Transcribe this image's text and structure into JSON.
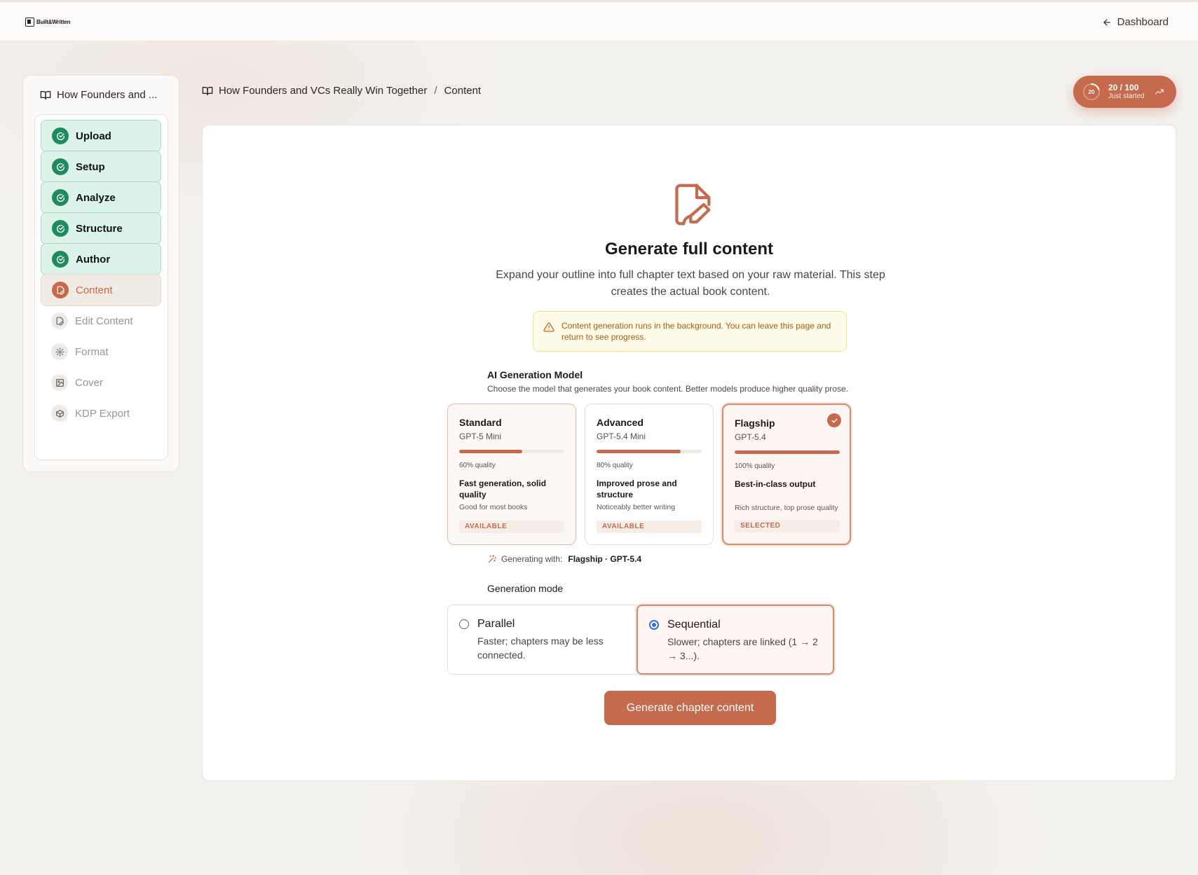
{
  "app": {
    "logo_text": "Built&Written"
  },
  "topbar": {
    "dashboard_label": "Dashboard"
  },
  "sidebar": {
    "book_title": "How Founders and ...",
    "steps": [
      {
        "label": "Upload",
        "state": "done",
        "icon": "check-circle-icon"
      },
      {
        "label": "Setup",
        "state": "done",
        "icon": "check-circle-icon"
      },
      {
        "label": "Analyze",
        "state": "done",
        "icon": "check-circle-icon"
      },
      {
        "label": "Structure",
        "state": "done",
        "icon": "check-circle-icon"
      },
      {
        "label": "Author",
        "state": "done",
        "icon": "check-circle-icon"
      },
      {
        "label": "Content",
        "state": "current",
        "icon": "file-pen-icon"
      },
      {
        "label": "Edit Content",
        "state": "todo",
        "icon": "file-pen-icon"
      },
      {
        "label": "Format",
        "state": "todo",
        "icon": "gear-icon"
      },
      {
        "label": "Cover",
        "state": "todo",
        "icon": "image-icon"
      },
      {
        "label": "KDP Export",
        "state": "todo",
        "icon": "package-icon"
      }
    ]
  },
  "breadcrumb": {
    "book": "How Founders and VCs Really Win Together",
    "separator": "/",
    "page": "Content"
  },
  "score": {
    "ring_value": "20",
    "value_text": "20 / 100",
    "status": "Just started",
    "progress_fraction": 0.2
  },
  "main": {
    "title": "Generate full content",
    "subtitle": "Expand your outline into full chapter text based on your raw material. This step creates the actual book content.",
    "notice": "Content generation runs in the background. You can leave this page and return to see progress.",
    "model_section": {
      "title": "AI Generation Model",
      "description": "Choose the model that generates your book content. Better models produce higher quality prose.",
      "models": [
        {
          "name": "Standard",
          "model": "GPT-5 Mini",
          "quality_pct": 60,
          "quality_label": "60% quality",
          "headline": "Fast generation, solid quality",
          "detail": "Good for most books",
          "status": "AVAILABLE"
        },
        {
          "name": "Advanced",
          "model": "GPT-5.4 Mini",
          "quality_pct": 80,
          "quality_label": "80% quality",
          "headline": "Improved prose and structure",
          "detail": "Noticeably better writing",
          "status": "AVAILABLE"
        },
        {
          "name": "Flagship",
          "model": "GPT-5.4",
          "quality_pct": 100,
          "quality_label": "100% quality",
          "headline": "Best-in-class output",
          "detail": "Rich structure, top prose quality",
          "status": "SELECTED"
        }
      ],
      "generating_with_label": "Generating with:",
      "generating_with_value": "Flagship · GPT-5.4"
    },
    "mode_section": {
      "title": "Generation mode",
      "modes": [
        {
          "name": "Parallel",
          "description": "Faster; chapters may be less connected.",
          "selected": false
        },
        {
          "name": "Sequential",
          "description": "Slower; chapters are linked (1 → 2 → 3...).",
          "selected": true
        }
      ]
    },
    "generate_button": "Generate chapter content"
  },
  "colors": {
    "accent": "#c56a4d",
    "done_green": "#1f8a5e",
    "done_bg": "#dcf3ea",
    "notice_bg": "#fefce8",
    "radio_blue": "#2f6fe4"
  }
}
